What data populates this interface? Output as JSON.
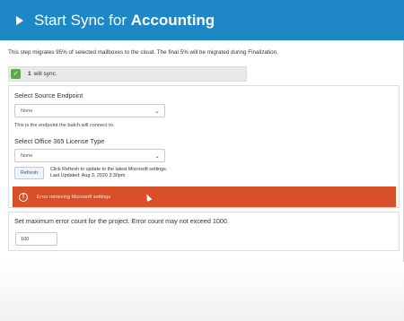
{
  "header": {
    "title_prefix": "Start Sync for ",
    "title_project": "Accounting"
  },
  "intro_text": "This step migrates 95% of selected mailboxes to the cloud. The final 5% will be migrated during Finalization.",
  "sync_status": {
    "count": "1",
    "text": "will sync."
  },
  "source_endpoint": {
    "label": "Select Source Endpoint",
    "value": "None",
    "hint": "This is the endpoint the batch will connect to."
  },
  "license_type": {
    "label": "Select Office 365 License Type",
    "value": "None"
  },
  "refresh": {
    "button_label": "Refresh",
    "info_line1": "Click Refresh to update to the latest Microsoft settings.",
    "info_line2": "Last Updated: Aug 3, 2020 3:30pm"
  },
  "error_banner": {
    "text": "Error retrieving Microsoft settings",
    "color": "#d94f27"
  },
  "error_count": {
    "label": "Set maximum error count for the project. Error count may not exceed 1000.",
    "value": "100"
  },
  "colors": {
    "header": "#1e88c7",
    "sync_check": "#5aa94a"
  }
}
